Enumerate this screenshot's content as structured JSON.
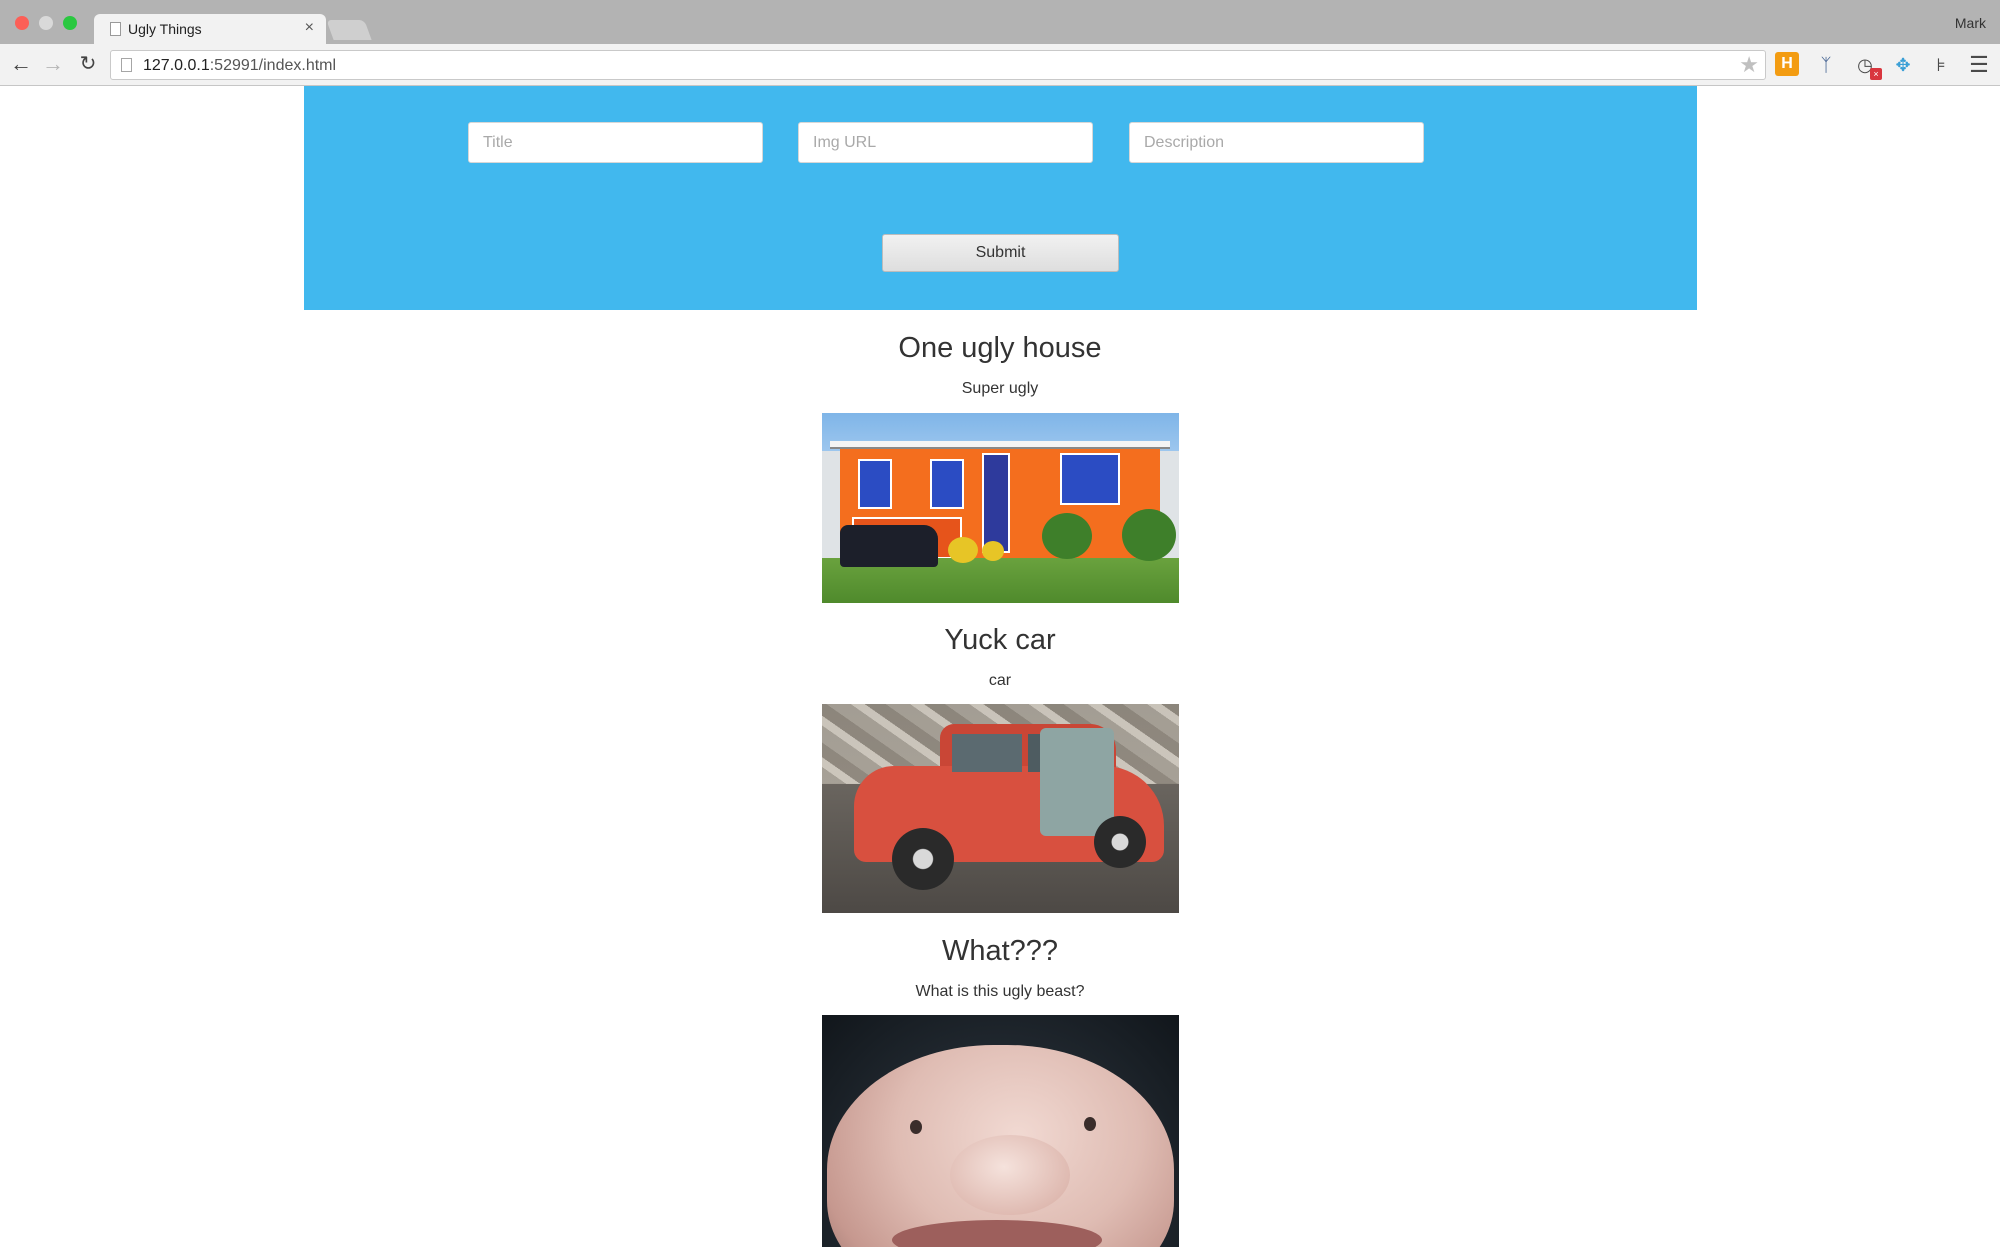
{
  "browser": {
    "tab_title": "Ugly Things",
    "tab_close": "×",
    "profile": "Mark",
    "url_host": "127.0.0.1",
    "url_rest": ":52991/index.html",
    "ext_h_label": "H"
  },
  "form": {
    "title_placeholder": "Title",
    "img_placeholder": "Img URL",
    "desc_placeholder": "Description",
    "submit_label": "Submit"
  },
  "items": [
    {
      "title": "One ugly house",
      "description": "Super ugly"
    },
    {
      "title": "Yuck car",
      "description": "car"
    },
    {
      "title": "What???",
      "description": "What is this ugly beast?"
    }
  ],
  "colors": {
    "hero_bg": "#41b8ee",
    "text": "#333333"
  },
  "icons": {
    "back": "back-arrow-icon",
    "forward": "forward-arrow-icon",
    "reload": "reload-icon",
    "star": "star-icon",
    "menu": "hamburger-menu-icon"
  }
}
